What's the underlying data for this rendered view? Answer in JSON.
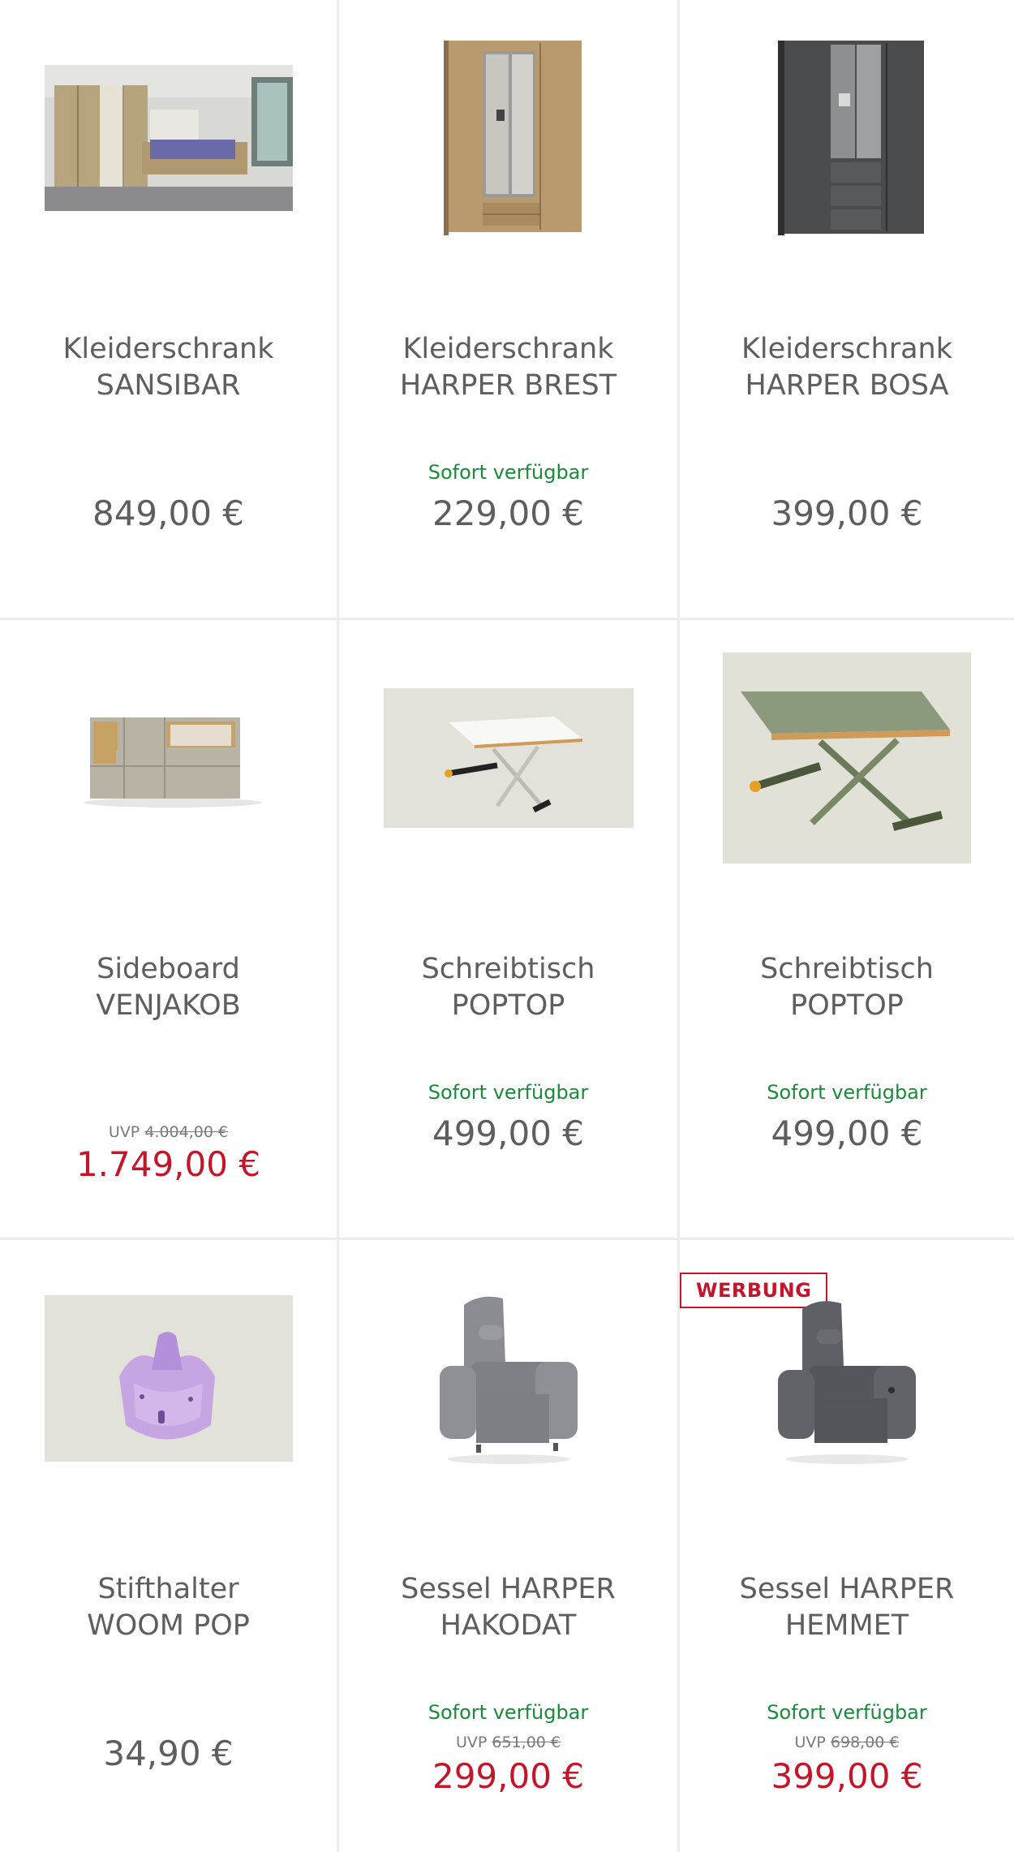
{
  "products": [
    {
      "name1": "Kleiderschrank",
      "name2": "SANSIBAR",
      "availability": "",
      "uvp_label": "",
      "uvp_value": "",
      "price": "849,00 €",
      "image": "bedroom-wardrobe-image"
    },
    {
      "name1": "Kleiderschrank",
      "name2": "HARPER BREST",
      "availability": "Sofort verfügbar",
      "uvp_label": "",
      "uvp_value": "",
      "price": "229,00 €",
      "image": "oak-wardrobe-image"
    },
    {
      "name1": "Kleiderschrank",
      "name2": "HARPER BOSA",
      "availability": "",
      "uvp_label": "",
      "uvp_value": "",
      "price": "399,00 €",
      "image": "grey-wardrobe-image"
    },
    {
      "name1": "Sideboard",
      "name2": "VENJAKOB",
      "availability": "",
      "uvp_label": "UVP",
      "uvp_value": "4.004,00 €",
      "price": "1.749,00 €",
      "image": "sideboard-image"
    },
    {
      "name1": "Schreibtisch",
      "name2": "POPTOP",
      "availability": "Sofort verfügbar",
      "uvp_label": "",
      "uvp_value": "",
      "price": "499,00 €",
      "image": "white-desk-image"
    },
    {
      "name1": "Schreibtisch",
      "name2": "POPTOP",
      "availability": "Sofort verfügbar",
      "uvp_label": "",
      "uvp_value": "",
      "price": "499,00 €",
      "image": "green-desk-image"
    },
    {
      "name1": "Stifthalter",
      "name2": "WOOM POP",
      "availability": "",
      "uvp_label": "",
      "uvp_value": "",
      "price": "34,90 €",
      "image": "pen-holder-image"
    },
    {
      "name1": "Sessel HARPER",
      "name2": "HAKODAT",
      "availability": "Sofort verfügbar",
      "uvp_label": "UVP",
      "uvp_value": "651,00 €",
      "price": "299,00 €",
      "image": "light-armchair-image"
    },
    {
      "name1": "Sessel HARPER",
      "name2": "HEMMET",
      "availability": "Sofort verfügbar",
      "uvp_label": "UVP",
      "uvp_value": "698,00 €",
      "price": "399,00 €",
      "image": "dark-armchair-image"
    }
  ],
  "badge": "WERBUNG",
  "colors": {
    "available": "#1a8a3b",
    "sale": "#c4152a",
    "text": "#5e5e5e"
  }
}
